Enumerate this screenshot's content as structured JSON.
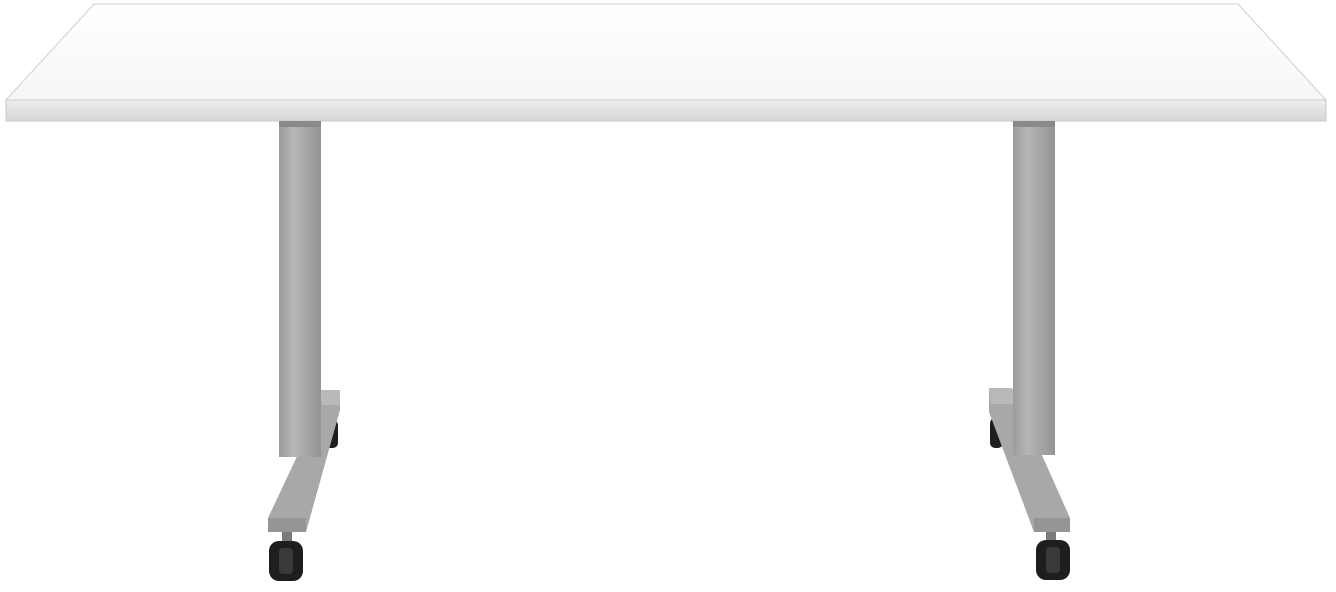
{
  "scene": {
    "subject": "rolling-training-table",
    "colors": {
      "background": "#ffffff",
      "tabletop": "#fbfbfb",
      "tabletop_edge": "#d9d9d9",
      "frame": "#a9a9a9",
      "frame_shadow": "#8e8e8e",
      "caster": "#222222"
    }
  }
}
